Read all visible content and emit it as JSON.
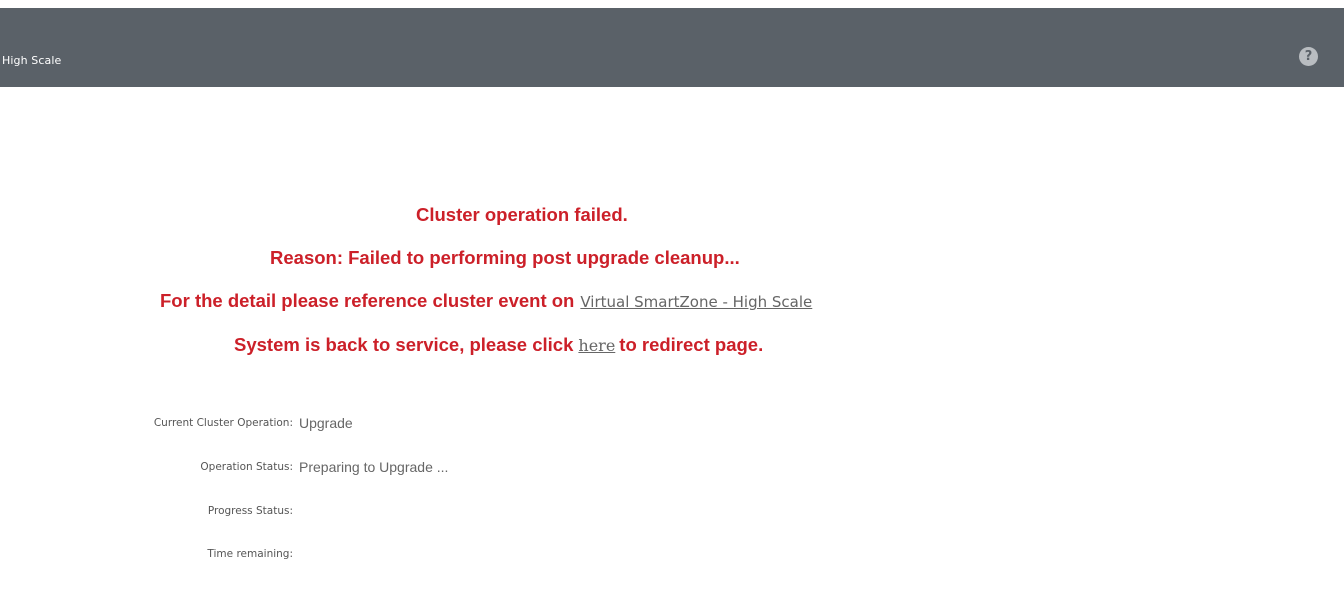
{
  "header": {
    "title": "High Scale",
    "help_icon": "question-circle-icon",
    "background_color": "#5a6168"
  },
  "messages": {
    "line1": "Cluster operation failed.",
    "line2": "Reason: Failed to performing post upgrade cleanup...",
    "line3_prefix": "For the detail please reference cluster event on",
    "line3_link": "Virtual SmartZone - High Scale",
    "line4_prefix": "System is back to service, please click",
    "line4_link": "here",
    "line4_suffix": "to redirect page.",
    "error_color": "#cc2029"
  },
  "status": {
    "current_operation_label": "Current Cluster Operation:",
    "current_operation_value": "Upgrade",
    "operation_status_label": "Operation Status:",
    "operation_status_value": "Preparing to Upgrade ...",
    "progress_status_label": "Progress Status:",
    "progress_status_value": "",
    "time_remaining_label": "Time remaining:",
    "time_remaining_value": ""
  }
}
